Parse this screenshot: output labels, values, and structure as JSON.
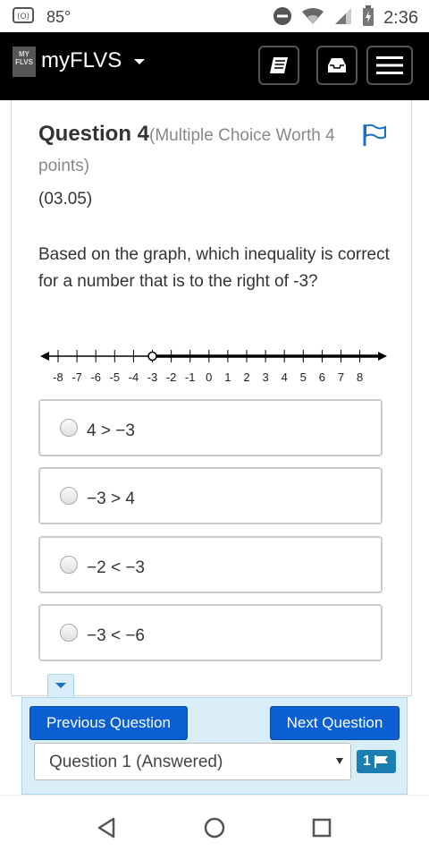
{
  "status_bar": {
    "left_icon": "cast-icon",
    "temperature": "85°",
    "time": "2:36",
    "right_icons": [
      "do-not-disturb-icon",
      "wifi-icon",
      "signal-icon",
      "battery-icon"
    ]
  },
  "navbar": {
    "logo_text": "MY FLVS",
    "brand": "myFLVS",
    "buttons": [
      "book-icon",
      "inbox-icon",
      "menu-icon"
    ]
  },
  "question": {
    "title": "Question 4",
    "meta": "(Multiple Choice Worth 4 points)",
    "code": "(03.05)",
    "prompt": "Based on the graph, which inequality is correct for a number that is to the right of -3?"
  },
  "number_line": {
    "ticks": [
      "-8",
      "-7",
      "-6",
      "-5",
      "-4",
      "-3",
      "-2",
      "-1",
      "0",
      "1",
      "2",
      "3",
      "4",
      "5",
      "6",
      "7",
      "8"
    ],
    "open_circle_at": -3,
    "ray_direction": "right"
  },
  "choices": [
    {
      "label": "4 > −3"
    },
    {
      "label": "−3 > 4"
    },
    {
      "label": "−2 < −3"
    },
    {
      "label": "−3 < −6"
    }
  ],
  "navigation": {
    "prev_label": "Previous Question",
    "next_label": "Next Question",
    "select_value": "Question 1 (Answered)",
    "flag_count": "1"
  },
  "colors": {
    "accent": "#0a5fd2",
    "panel": "#d9eef8",
    "flag": "#1a7fb0"
  }
}
